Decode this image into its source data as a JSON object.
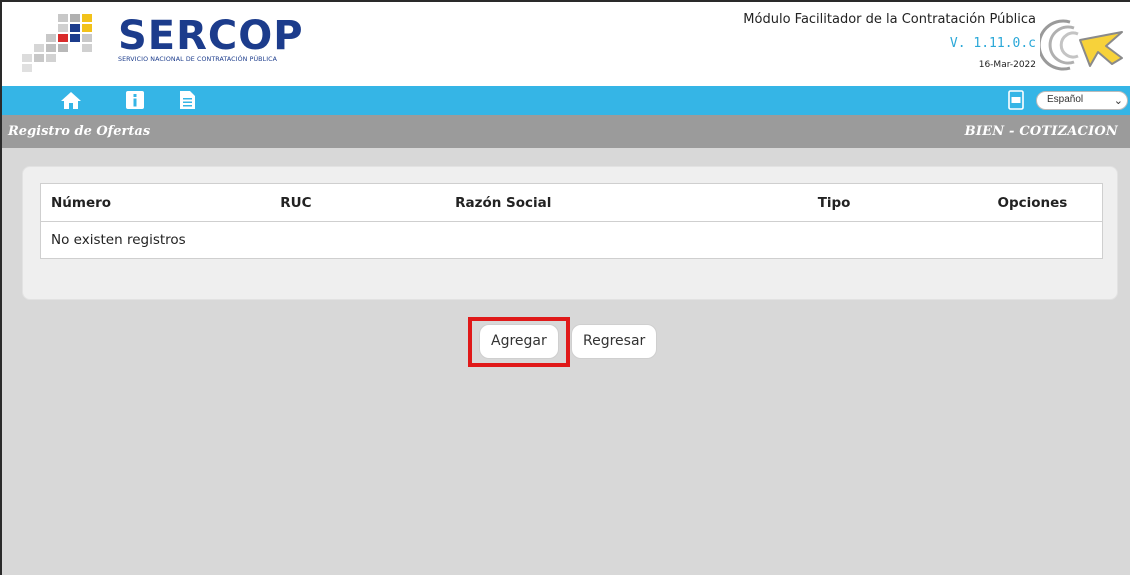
{
  "header": {
    "logo_text": "SERCOP",
    "logo_subtitle": "SERVICIO NACIONAL DE CONTRATACIÓN PÚBLICA",
    "app_title": "Módulo Facilitador de la Contratación Pública",
    "version": "V. 1.11.0.c",
    "date": "16-Mar-2022"
  },
  "navbar": {
    "icons": [
      "home-icon",
      "info-icon",
      "document-icon"
    ],
    "pdf_icon": "pdf-icon",
    "language": "Español"
  },
  "titlebar": {
    "left": "Registro de Ofertas",
    "right": "BIEN - COTIZACION"
  },
  "table": {
    "columns": [
      "Número",
      "RUC",
      "Razón Social",
      "Tipo",
      "Opciones"
    ],
    "empty_message": "No existen registros"
  },
  "actions": {
    "add_label": "Agregar",
    "back_label": "Regresar"
  },
  "colors": {
    "navbar": "#35b5e6",
    "titlebar": "#9b9b9b",
    "content_bg": "#d8d8d8",
    "logo_blue": "#1c3c8c",
    "highlight": "#e01919"
  }
}
